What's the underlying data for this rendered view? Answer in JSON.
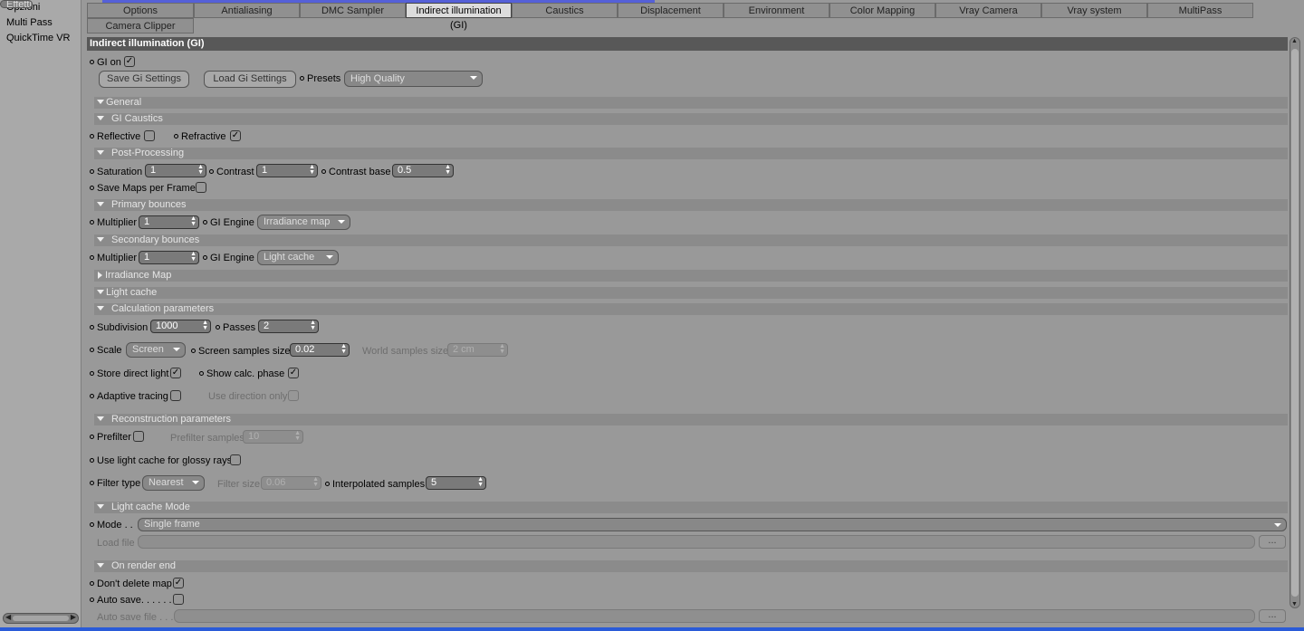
{
  "sidebar": {
    "items": [
      "Effetti",
      "Opzioni",
      "Multi Pass",
      "QuickTime VR"
    ]
  },
  "tabs": [
    "Options",
    "Antialiasing",
    "DMC Sampler",
    "Indirect illumination (GI)",
    "Caustics",
    "Displacement",
    "Environment",
    "Color Mapping",
    "Vray Camera",
    "Vray system",
    "MultiPass",
    "Camera Clipper"
  ],
  "panel_title": "Indirect illumination (GI)",
  "gi": {
    "gi_on_label": "GI on",
    "gi_on": true,
    "save_btn": "Save Gi Settings",
    "load_btn": "Load Gi Settings",
    "presets_label": "Presets",
    "presets_value": "High Quality"
  },
  "sections": {
    "general": "General",
    "gi_caustics": "GI Caustics",
    "post_processing": "Post-Processing",
    "primary": "Primary bounces",
    "secondary": "Secondary bounces",
    "irradiance": "Irradiance Map",
    "light_cache": "Light cache",
    "calc_params": "Calculation parameters",
    "recon_params": "Reconstruction parameters",
    "lc_mode": "Light cache Mode",
    "on_render_end": "On render end"
  },
  "caustics": {
    "reflective": "Reflective",
    "reflective_on": false,
    "refractive": "Refractive",
    "refractive_on": true
  },
  "post": {
    "saturation_label": "Saturation",
    "saturation": "1",
    "contrast_label": "Contrast",
    "contrast": "1",
    "contrast_base_label": "Contrast base",
    "contrast_base": "0.5",
    "save_maps_label": "Save Maps per Frame"
  },
  "primary": {
    "multiplier_label": "Multiplier",
    "multiplier": "1",
    "engine_label": "GI Engine",
    "engine": "Irradiance map"
  },
  "secondary": {
    "multiplier_label": "Multiplier",
    "multiplier": "1",
    "engine_label": "GI Engine",
    "engine": "Light cache"
  },
  "calc": {
    "subdivision_label": "Subdivision",
    "subdivision": "1000",
    "passes_label": "Passes",
    "passes": "2",
    "scale_label": "Scale",
    "scale": "Screen",
    "screen_samples_label": "Screen samples size",
    "screen_samples": "0.02",
    "world_samples_label": "World samples size",
    "world_samples": "2 cm",
    "store_direct_label": "Store direct light",
    "store_direct": true,
    "show_calc_label": "Show calc. phase",
    "show_calc": true,
    "adaptive_label": "Adaptive tracing",
    "adaptive": false,
    "use_direction_label": "Use direction only"
  },
  "recon": {
    "prefilter_label": "Prefilter",
    "prefilter_samples_label": "Prefilter samples",
    "prefilter_samples": "10",
    "glossy_label": "Use light cache for glossy rays",
    "filter_type_label": "Filter type",
    "filter_type": "Nearest",
    "filter_size_label": "Filter size",
    "filter_size": "0.06",
    "interp_label": "Interpolated samples",
    "interp": "5"
  },
  "mode": {
    "mode_label": "Mode . .",
    "mode": "Single frame",
    "load_file_label": "Load file",
    "browse": "..."
  },
  "render_end": {
    "dont_delete_label": "Don't delete map",
    "dont_delete": true,
    "auto_save_label": "Auto save. . . . . .",
    "auto_save_file_label": "Auto save file . . .",
    "browse": "..."
  },
  "colors": {
    "panel_bg": "#999999",
    "title_bar": "#585858",
    "active_tab": "#dcdcdc",
    "taskbar": "#2a5bd8"
  }
}
